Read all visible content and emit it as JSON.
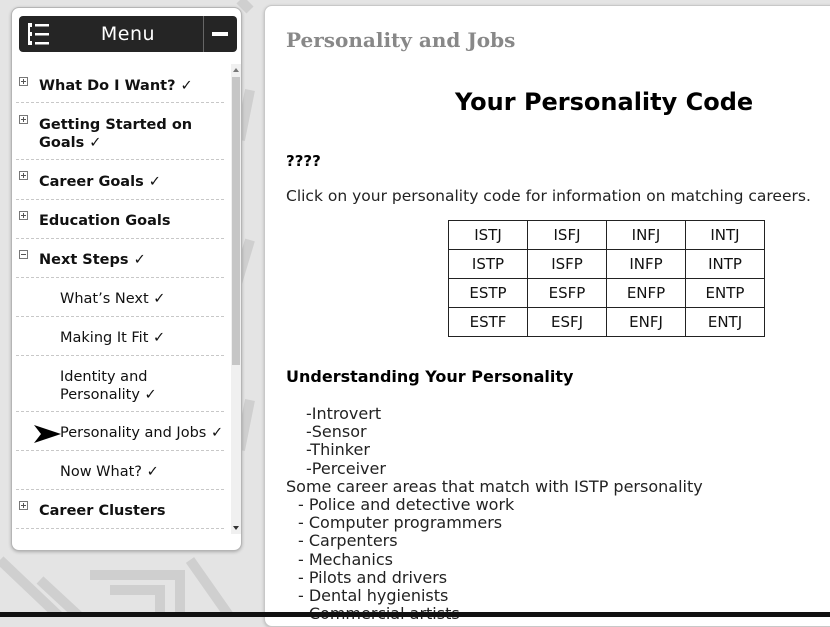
{
  "menu": {
    "title": "Menu"
  },
  "nav": {
    "items": [
      {
        "label": "What Do I Want? ✓",
        "expander": "plus"
      },
      {
        "label": "Getting Started on Goals ✓",
        "expander": "plus"
      },
      {
        "label": "Career Goals ✓",
        "expander": "plus"
      },
      {
        "label": "Education Goals",
        "expander": "plus"
      },
      {
        "label": "Next Steps ✓",
        "expander": "minus"
      },
      {
        "label": "What’s Next ✓"
      },
      {
        "label": "Making It Fit ✓"
      },
      {
        "label": "Identity and Personality ✓"
      },
      {
        "label": "Personality and Jobs ✓",
        "current": true
      },
      {
        "label": "Now What? ✓"
      },
      {
        "label": "Career Clusters",
        "expander": "plus"
      }
    ]
  },
  "main": {
    "page_title": "Personality and Jobs",
    "heading": "Your Personality Code",
    "question": "????",
    "instruction": "Click on your personality code for information on matching careers.",
    "codes": [
      [
        "ISTJ",
        "ISFJ",
        "INFJ",
        "INTJ"
      ],
      [
        "ISTP",
        "ISFP",
        "INFP",
        "INTP"
      ],
      [
        "ESTP",
        "ESFP",
        "ENFP",
        "ENTP"
      ],
      [
        "ESTF",
        "ESFJ",
        "ENFJ",
        "ENTJ"
      ]
    ],
    "subheading": "Understanding Your Personality",
    "traits": [
      "-Introvert",
      "-Sensor",
      "-Thinker",
      "-Perceiver"
    ],
    "careers_intro": "Some career areas that match with ISTP personality",
    "careers": [
      "- Police and detective work",
      "- Computer programmers",
      "- Carpenters",
      "- Mechanics",
      "- Pilots and drivers",
      "- Dental hygienists",
      "- Commercial artists"
    ]
  }
}
